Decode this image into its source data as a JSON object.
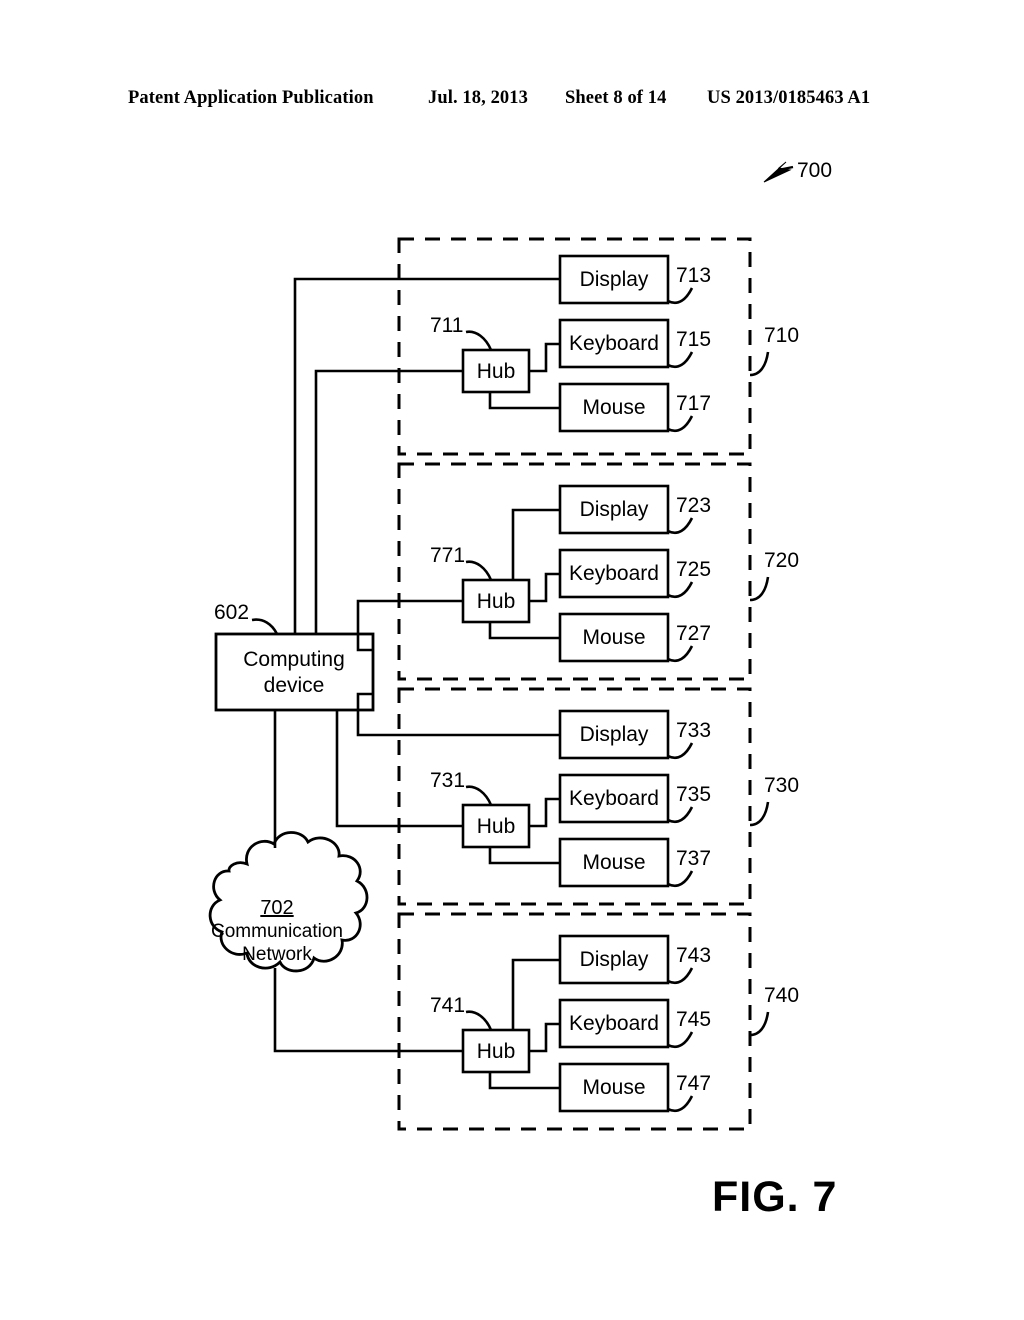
{
  "header": {
    "publication": "Patent Application Publication",
    "date": "Jul. 18, 2013",
    "sheet": "Sheet 8 of 14",
    "patent_number": "US 2013/0185463 A1"
  },
  "figure": {
    "caption": "FIG. 7",
    "overall_ref": "700",
    "line_color": "#000000",
    "background": "#ffffff"
  },
  "computing_device": {
    "ref": "602",
    "label_line1": "Computing",
    "label_line2": "device"
  },
  "network_cloud": {
    "ref": "702",
    "label_line1": "Communication",
    "label_line2": "Network"
  },
  "groups": [
    {
      "ref": "710",
      "hub": {
        "label": "Hub",
        "ref": "711"
      },
      "display": {
        "label": "Display",
        "ref": "713"
      },
      "keyboard": {
        "label": "Keyboard",
        "ref": "715"
      },
      "mouse": {
        "label": "Mouse",
        "ref": "717"
      },
      "display_wiring": "direct-to-computing-device"
    },
    {
      "ref": "720",
      "hub": {
        "label": "Hub",
        "ref": "771"
      },
      "display": {
        "label": "Display",
        "ref": "723"
      },
      "keyboard": {
        "label": "Keyboard",
        "ref": "725"
      },
      "mouse": {
        "label": "Mouse",
        "ref": "727"
      },
      "display_wiring": "through-hub"
    },
    {
      "ref": "730",
      "hub": {
        "label": "Hub",
        "ref": "731"
      },
      "display": {
        "label": "Display",
        "ref": "733"
      },
      "keyboard": {
        "label": "Keyboard",
        "ref": "735"
      },
      "mouse": {
        "label": "Mouse",
        "ref": "737"
      },
      "display_wiring": "direct-to-computing-device"
    },
    {
      "ref": "740",
      "hub": {
        "label": "Hub",
        "ref": "741"
      },
      "display": {
        "label": "Display",
        "ref": "743"
      },
      "keyboard": {
        "label": "Keyboard",
        "ref": "745"
      },
      "mouse": {
        "label": "Mouse",
        "ref": "747"
      },
      "display_wiring": "through-hub"
    }
  ]
}
